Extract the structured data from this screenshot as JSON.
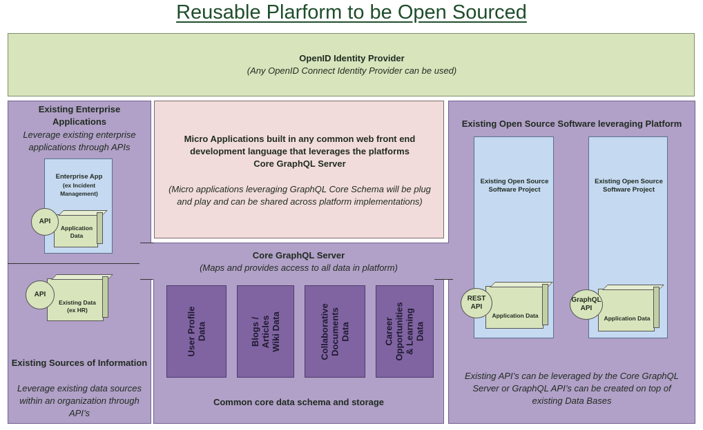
{
  "title": "Reusable Plarform to be Open Sourced",
  "identity": {
    "title": "OpenID Identity Provider",
    "subtitle": "(Any OpenID Connect Identity Provider can be used)"
  },
  "enterprise": {
    "title_line1": "Existing Enterprise",
    "title_line2": "Applications",
    "desc_line1": "Leverage existing enterprise",
    "desc_line2": "applications through APIs",
    "app_line1": "Enterprise App",
    "app_line2": "(ex Incident",
    "app_line3": "Management)",
    "api": "API",
    "data_line1": "Application",
    "data_line2": "Data"
  },
  "micro": {
    "line1": "Micro Applications built in any common web front end",
    "line2": "development language that leverages the platforms",
    "line3": "Core GraphQL Server",
    "note_line1": "(Micro applications leveraging GraphQL Core Schema will be plug",
    "note_line2": "and play and can be shared across platform implementations)"
  },
  "core": {
    "title": "Core GraphQL Server",
    "subtitle": "(Maps and provides access to all data in platform)",
    "schema_label": "Common core data schema and storage",
    "stores": [
      "User Profile\nData",
      "Blogs / Articles\nWiki Data",
      "Collaborative\nDocuments\nData",
      "Career\nOpportunities\n& Learning Data"
    ]
  },
  "sources": {
    "api": "API",
    "data_line1": "Existing Data",
    "data_line2": "(ex HR)",
    "title": "Existing Sources of Information",
    "desc_line1": "Leverage existing data sources",
    "desc_line2": "within an organization through",
    "desc_line3": "API’s"
  },
  "oss": {
    "title": "Existing Open Source Software leveraging Platform",
    "project1_line1": "Existing Open Source",
    "project1_line2": "Software Project",
    "project1_api_line1": "REST",
    "project1_api_line2": "API",
    "project1_data": "Application Data",
    "project2_line1": "Existing Open Source",
    "project2_line2": "Software Project",
    "project2_api_line1": "GraphQL",
    "project2_api_line2": "API",
    "project2_data": "Application Data",
    "note_line1": "Existing API’s can be leveraged by the Core GraphQL",
    "note_line2": "Server or GraphQL API’s can be created on top of",
    "note_line3": "existing Data Bases"
  },
  "colors": {
    "identity": "#d8e4bc",
    "platform": "#b1a0c7",
    "micro": "#f2dcdb",
    "project": "#c5d9f1",
    "storage": "#8064a2"
  }
}
